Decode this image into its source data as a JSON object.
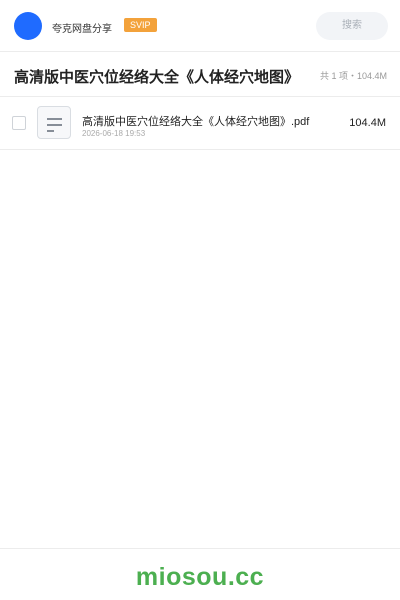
{
  "header": {
    "avatar_icon": "user-avatar",
    "username": "夸克网盘分享",
    "badge": "SVIP",
    "search_placeholder": "搜索",
    "colors": {
      "avatar": "#1f6bff",
      "badge": "#f3a23b"
    }
  },
  "folder": {
    "title": "高清版中医穴位经络大全《人体经穴地图》",
    "summary": "共 1 项・104.4M"
  },
  "files": [
    {
      "icon": "document-icon",
      "name": "高清版中医穴位经络大全《人体经穴地图》.pdf",
      "date": "2026-06-18 19:53",
      "size": "104.4M"
    }
  ],
  "footer": {
    "watermark": "miosou.cc",
    "color": "#4caf50"
  }
}
